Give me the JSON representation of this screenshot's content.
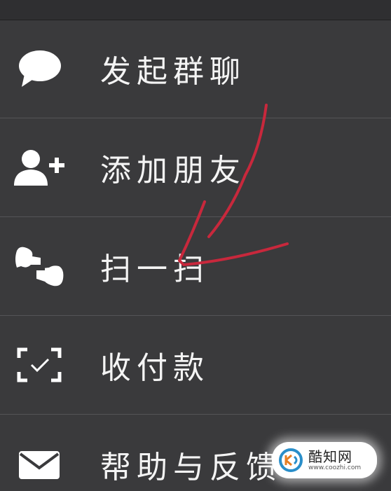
{
  "menu": {
    "items": [
      {
        "label": "发起群聊",
        "icon": "chat-bubble-icon"
      },
      {
        "label": "添加朋友",
        "icon": "add-friend-icon"
      },
      {
        "label": "扫一扫",
        "icon": "scan-icon"
      },
      {
        "label": "收付款",
        "icon": "payment-scan-icon"
      },
      {
        "label": "帮助与反馈",
        "icon": "envelope-icon"
      }
    ]
  },
  "annotation": {
    "color": "#c8283c",
    "icon": "arrow-annotation"
  },
  "watermark": {
    "name": "酷知网",
    "url": "www.coozhi.com",
    "icon": "coozhi-logo-icon"
  },
  "colors": {
    "background": "#3a3a3c",
    "divider": "#545457",
    "text": "#f4f4f4"
  }
}
